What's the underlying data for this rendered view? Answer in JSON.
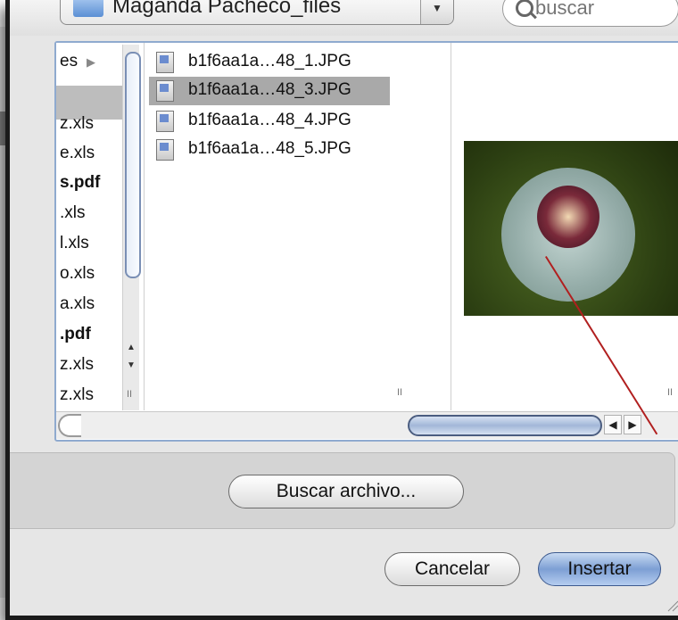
{
  "toolbar": {
    "path_label": "Maganda Pacheco_files",
    "search_placeholder": "buscar"
  },
  "column1": {
    "items": [
      {
        "label": "es",
        "selected": true
      },
      {
        "label": "z.xls"
      },
      {
        "label": "e.xls"
      },
      {
        "label": "s.pdf"
      },
      {
        "label": ".xls"
      },
      {
        "label": "l.xls"
      },
      {
        "label": "o.xls"
      },
      {
        "label": "a.xls"
      },
      {
        "label": ".pdf"
      },
      {
        "label": "z.xls"
      },
      {
        "label": "z.xls"
      }
    ]
  },
  "files": [
    {
      "name": "b1f6aa1a…48_1.JPG"
    },
    {
      "name": "b1f6aa1a…48_3.JPG",
      "selected": true
    },
    {
      "name": "b1f6aa1a…48_4.JPG"
    },
    {
      "name": "b1f6aa1a…48_5.JPG"
    }
  ],
  "buttons": {
    "find_file": "Buscar archivo...",
    "cancel": "Cancelar",
    "insert": "Insertar"
  },
  "colors": {
    "selection": "#a9a9a9",
    "accent": "#7d9fd4",
    "pointer": "#b11f1f"
  }
}
